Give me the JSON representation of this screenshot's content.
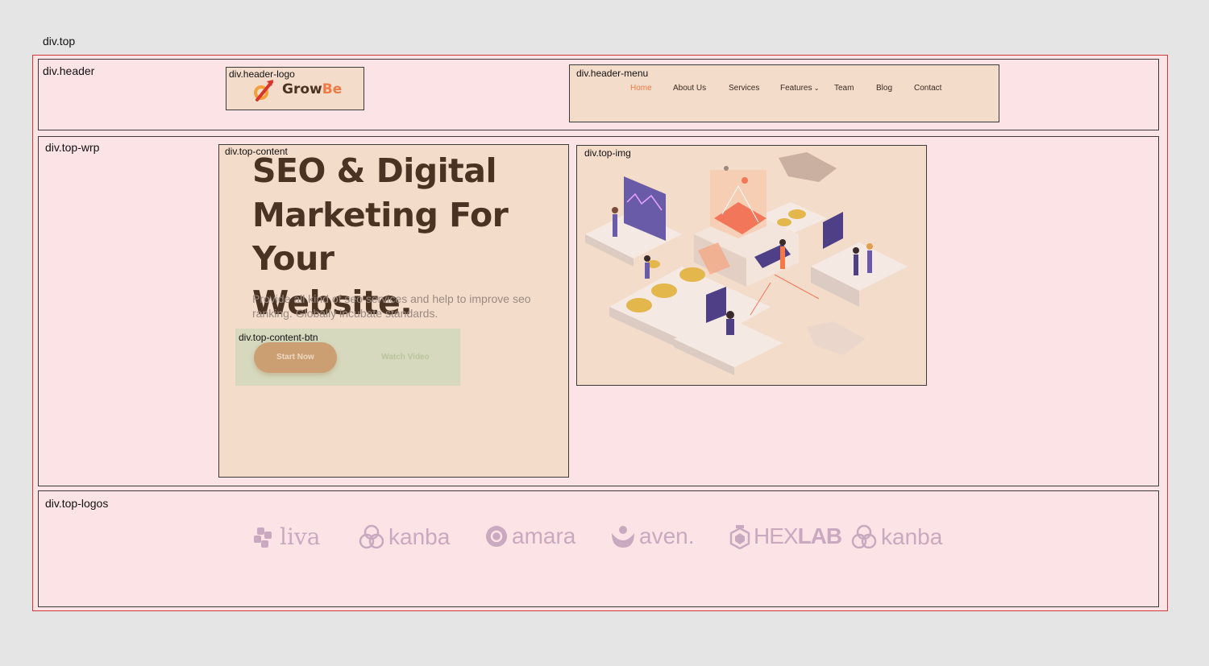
{
  "labels": {
    "top": "div.top",
    "header": "div.header",
    "header_logo": "div.header-logo",
    "header_menu": "div.header-menu",
    "top_wrp": "div.top-wrp",
    "top_content": "div.top-content",
    "top_content_btn": "div.top-content-btn",
    "top_img": "div.top-img",
    "top_logos": "div.top-logos"
  },
  "brand": {
    "name_part1": "Grow",
    "name_part2": "Be",
    "accent_color": "#ef7a45",
    "text_color": "#4a3323"
  },
  "menu": [
    {
      "label": "Home",
      "active": true
    },
    {
      "label": "About Us",
      "active": false
    },
    {
      "label": "Services",
      "active": false
    },
    {
      "label": "Features",
      "active": false,
      "has_dropdown": true
    },
    {
      "label": "Team",
      "active": false
    },
    {
      "label": "Blog",
      "active": false
    },
    {
      "label": "Contact",
      "active": false
    }
  ],
  "hero": {
    "title_line1": "SEO & Digital",
    "title_line2": "Marketing For Your",
    "title_line3": "Website.",
    "description": "Provide all kind of seo services and help to improve seo ranking. Globally incubate standards.",
    "start_button": "Start Now",
    "watch_button": "Watch Video"
  },
  "partner_logos": [
    {
      "name": "liva",
      "icon": "liva-icon"
    },
    {
      "name": "kanba",
      "icon": "kanba-icon"
    },
    {
      "name": "amara",
      "icon": "amara-icon"
    },
    {
      "name": "aven.",
      "icon": "aven-icon"
    },
    {
      "name_part1": "HEX",
      "name_part2": "LAB",
      "icon": "hexlab-icon"
    },
    {
      "name": "kanba",
      "icon": "kanba-icon"
    }
  ]
}
